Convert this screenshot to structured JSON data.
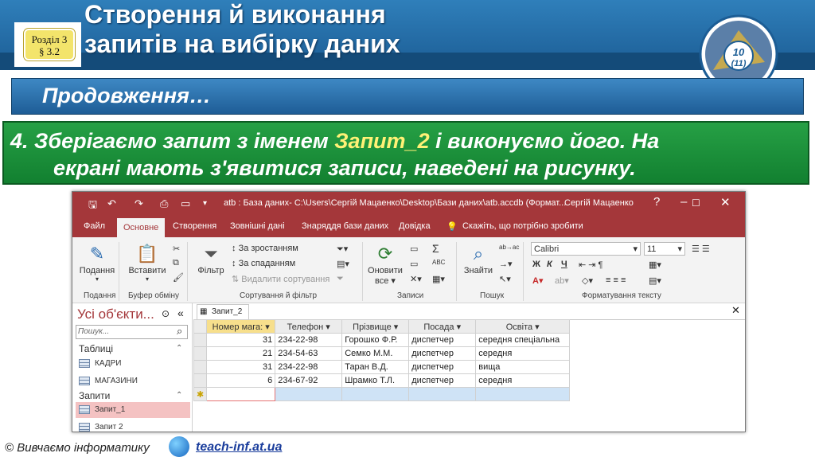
{
  "slide": {
    "badge": [
      "Розділ 3",
      "§ 3.2"
    ],
    "title_lines": [
      "Створення й виконання",
      "запитів на вибірку даних"
    ],
    "logo_text": "10",
    "logo_sub": "(11)",
    "subtitle": "Продовження…",
    "step_prefix": "4. Зберігаємо запит з іменем ",
    "step_highlight": "Запит_2",
    "step_suffix": " і виконуємо його. На",
    "step_line2": "екрані мають з'явитися записи, наведені на рисунку.",
    "footer_text": "© Вивчаємо інформатику",
    "footer_link": "teach-inf.at.ua"
  },
  "window": {
    "title": "atb : База даних- C:\\Users\\Сергій Мацаенко\\Desktop\\Бази даних\\atb.accdb (Формат...",
    "user": "Сергій Мацаенко",
    "help": "?",
    "tabs": [
      "Файл",
      "Основне",
      "Створення",
      "Зовнішні дані",
      "Знаряддя бази даних",
      "Довідка"
    ],
    "tell_me": "Скажіть, що потрібно зробити",
    "ribbon": {
      "paste_label": "Подання",
      "insert_label": "Вставити",
      "filter_label": "Фільтр",
      "sort_asc": "За зростанням",
      "sort_desc": "За спаданням",
      "remove_sort": "Видалити сортування",
      "refresh_label": "Оновити",
      "refresh_sub": "все",
      "find_label": "Знайти",
      "font_name": "Calibri",
      "font_size": "11",
      "groups": [
        "Подання",
        "Буфер обміну",
        "Сортування й фільтр",
        "Записи",
        "Пошук",
        "Форматування тексту"
      ]
    },
    "nav": {
      "title": "Усі об'єкти...",
      "search_placeholder": "Пошук...",
      "sections": [
        {
          "name": "Таблиці",
          "items": [
            "КАДРИ",
            "МАГАЗИНИ"
          ]
        },
        {
          "name": "Запити",
          "items": [
            "Запит_1",
            "Запит 2"
          ]
        }
      ]
    },
    "datasheet": {
      "tab": "Запит_2",
      "columns": [
        "Номер мага:",
        "Телефон",
        "Прізвище",
        "Посада",
        "Освіта"
      ],
      "rows": [
        [
          "31",
          "234-22-98",
          "Горошко Ф.Р.",
          "диспетчер",
          "середня спеціальна"
        ],
        [
          "21",
          "234-54-63",
          "Семко М.М.",
          "диспетчер",
          "середня"
        ],
        [
          "31",
          "234-22-98",
          "Таран В.Д.",
          "диспетчер",
          "вища"
        ],
        [
          "6",
          "234-67-92",
          "Шрамко Т.Л.",
          "диспетчер",
          "середня"
        ]
      ],
      "new_row_marker": "✱"
    }
  }
}
